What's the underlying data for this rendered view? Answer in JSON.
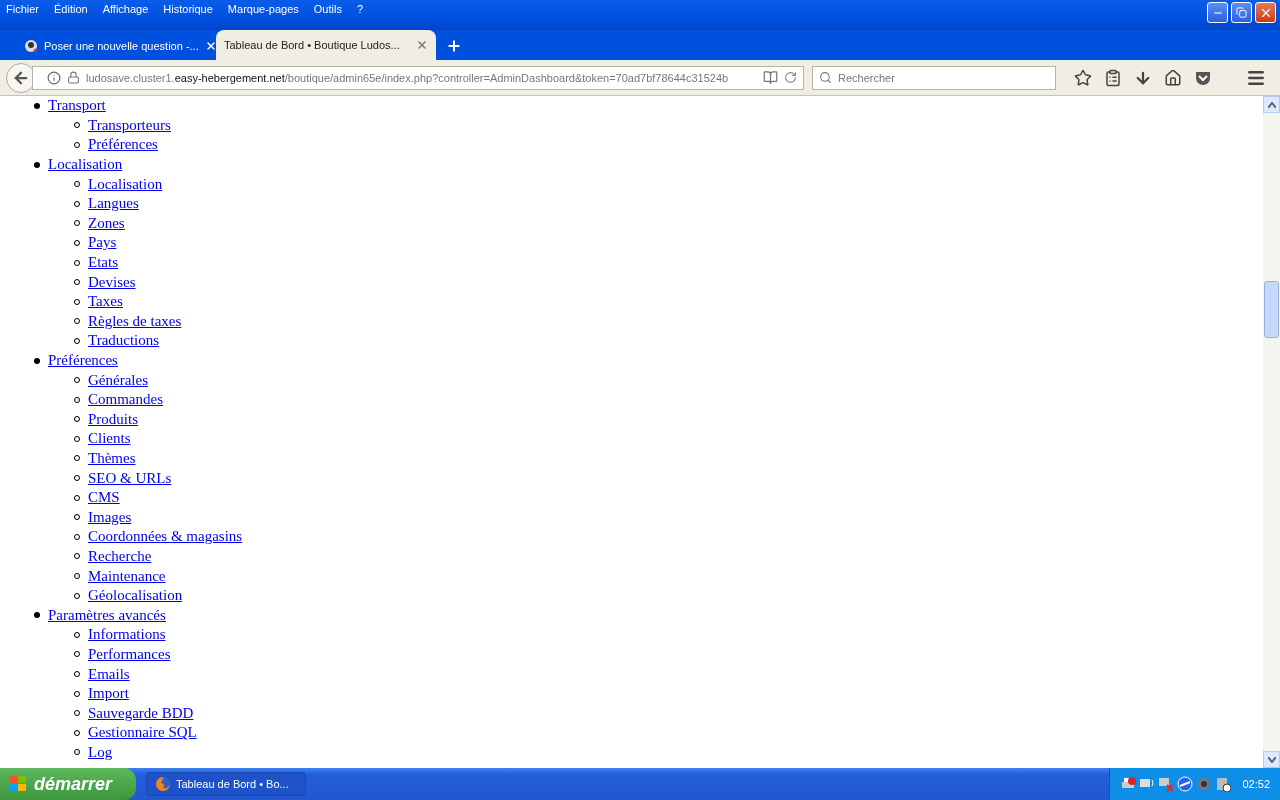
{
  "menu": [
    "Fichier",
    "Édition",
    "Affichage",
    "Historique",
    "Marque-pages",
    "Outils",
    "?"
  ],
  "tabs": [
    {
      "label": "Poser une nouvelle question -...",
      "selected": false
    },
    {
      "label": "Tableau de Bord • Boutique Ludos...",
      "selected": true
    }
  ],
  "address": {
    "subdomain": "ludosave.cluster1.",
    "domain": "easy-hebergement.net",
    "path": "/boutique/admin65e/index.php?controller=AdminDashboard&token=70ad7bf78644c31524b"
  },
  "search": {
    "placeholder": "Rechercher"
  },
  "nav": [
    {
      "label": "Transport",
      "children": [
        {
          "label": "Transporteurs"
        },
        {
          "label": "Préférences"
        }
      ]
    },
    {
      "label": "Localisation",
      "children": [
        {
          "label": "Localisation"
        },
        {
          "label": "Langues"
        },
        {
          "label": "Zones"
        },
        {
          "label": "Pays"
        },
        {
          "label": "Etats"
        },
        {
          "label": "Devises"
        },
        {
          "label": "Taxes"
        },
        {
          "label": "Règles de taxes"
        },
        {
          "label": "Traductions"
        }
      ]
    },
    {
      "label": "Préférences",
      "children": [
        {
          "label": "Générales"
        },
        {
          "label": "Commandes"
        },
        {
          "label": "Produits"
        },
        {
          "label": "Clients"
        },
        {
          "label": "Thèmes"
        },
        {
          "label": "SEO & URLs"
        },
        {
          "label": "CMS"
        },
        {
          "label": "Images"
        },
        {
          "label": "Coordonnées & magasins"
        },
        {
          "label": "Recherche"
        },
        {
          "label": "Maintenance"
        },
        {
          "label": "Géolocalisation"
        }
      ]
    },
    {
      "label": "Paramètres avancés",
      "children": [
        {
          "label": "Informations"
        },
        {
          "label": "Performances"
        },
        {
          "label": "Emails"
        },
        {
          "label": "Import"
        },
        {
          "label": "Sauvegarde BDD"
        },
        {
          "label": "Gestionnaire SQL"
        },
        {
          "label": "Log"
        }
      ]
    }
  ],
  "taskbar": {
    "start": "démarrer",
    "task": "Tableau de Bord • Bo...",
    "clock": "02:52"
  }
}
